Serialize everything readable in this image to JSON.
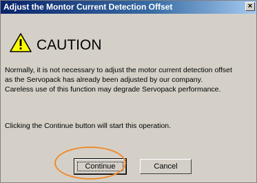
{
  "dialog": {
    "title": "Adjust the Montor Current Detection Offset",
    "close_glyph": "×",
    "caution_label": "CAUTION",
    "message_lines": [
      "Normally, it is not necessary to adjust the motor current detection offset",
      "as the Servopack has already been adjusted by our company.",
      "Careless use of this function may degrade Servopack performance."
    ],
    "instruction": "Clicking the Continue button will start this operation.",
    "buttons": {
      "continue_label": "Continue",
      "cancel_label": "Cancel"
    }
  },
  "icons": {
    "warning": "warning-triangle-icon",
    "close": "close-icon"
  },
  "colors": {
    "title_bar_start": "#0a246a",
    "title_bar_end": "#a6caf0",
    "warning_fill": "#ffff00",
    "highlight_ring": "#f08a2c"
  }
}
